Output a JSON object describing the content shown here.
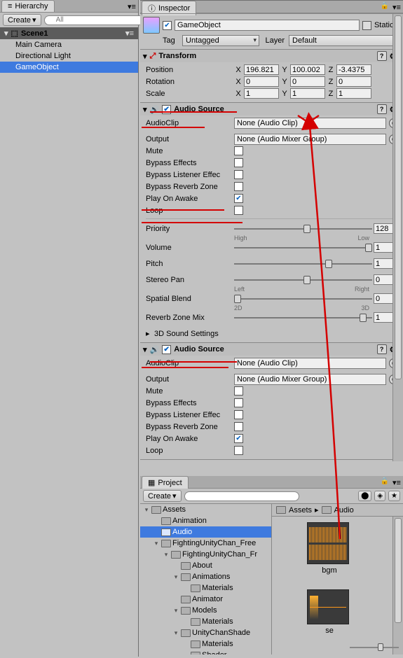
{
  "hierarchy": {
    "tab": "Hierarchy",
    "create": "Create",
    "search_placeholder": "All",
    "scene": "Scene1",
    "items": [
      "Main Camera",
      "Directional Light",
      "GameObject"
    ],
    "selected_index": 2
  },
  "inspector": {
    "tab": "Inspector",
    "gameobject": {
      "active": true,
      "name": "GameObject",
      "static": "Static",
      "tag_label": "Tag",
      "tag": "Untagged",
      "layer_label": "Layer",
      "layer": "Default"
    },
    "transform": {
      "title": "Transform",
      "position": {
        "label": "Position",
        "x": "196.821",
        "y": "100.002",
        "z": "-3.4375"
      },
      "rotation": {
        "label": "Rotation",
        "x": "0",
        "y": "0",
        "z": "0"
      },
      "scale": {
        "label": "Scale",
        "x": "1",
        "y": "1",
        "z": "1"
      }
    },
    "audio1": {
      "title": "Audio Source",
      "audioclip": {
        "label": "AudioClip",
        "value": "None (Audio Clip)"
      },
      "output": {
        "label": "Output",
        "value": "None (Audio Mixer Group)"
      },
      "mute": {
        "label": "Mute",
        "value": false
      },
      "bypass_effects": {
        "label": "Bypass Effects",
        "value": false
      },
      "bypass_listener": {
        "label": "Bypass Listener Effec",
        "value": false
      },
      "bypass_reverb": {
        "label": "Bypass Reverb Zone",
        "value": false
      },
      "play_on_awake": {
        "label": "Play On Awake",
        "value": true
      },
      "loop": {
        "label": "Loop",
        "value": false
      },
      "priority": {
        "label": "Priority",
        "low": "High",
        "high": "Low",
        "value": "128",
        "pct": 50
      },
      "volume": {
        "label": "Volume",
        "value": "1",
        "pct": 100
      },
      "pitch": {
        "label": "Pitch",
        "value": "1",
        "pct": 66
      },
      "stereo": {
        "label": "Stereo Pan",
        "low": "Left",
        "high": "Right",
        "value": "0",
        "pct": 50
      },
      "spatial": {
        "label": "Spatial Blend",
        "low": "2D",
        "high": "3D",
        "value": "0",
        "pct": 0
      },
      "reverbmix": {
        "label": "Reverb Zone Mix",
        "value": "1",
        "pct": 91
      },
      "sound3d": "3D Sound Settings"
    },
    "audio2": {
      "title": "Audio Source",
      "audioclip": {
        "label": "AudioClip",
        "value": "None (Audio Clip)"
      },
      "output": {
        "label": "Output",
        "value": "None (Audio Mixer Group)"
      },
      "mute": {
        "label": "Mute",
        "value": false
      },
      "bypass_effects": {
        "label": "Bypass Effects",
        "value": false
      },
      "bypass_listener": {
        "label": "Bypass Listener Effec",
        "value": false
      },
      "bypass_reverb": {
        "label": "Bypass Reverb Zone",
        "value": false
      },
      "play_on_awake": {
        "label": "Play On Awake",
        "value": true
      },
      "loop": {
        "label": "Loop",
        "value": false
      }
    }
  },
  "project": {
    "tab": "Project",
    "create": "Create",
    "search_placeholder": "",
    "tree": [
      {
        "depth": 0,
        "fold": "▾",
        "label": "Assets"
      },
      {
        "depth": 1,
        "fold": "",
        "label": "Animation"
      },
      {
        "depth": 1,
        "fold": "",
        "label": "Audio",
        "selected": true
      },
      {
        "depth": 1,
        "fold": "▾",
        "label": "FightingUnityChan_Free"
      },
      {
        "depth": 2,
        "fold": "▾",
        "label": "FightingUnityChan_Fr"
      },
      {
        "depth": 3,
        "fold": "",
        "label": "About"
      },
      {
        "depth": 3,
        "fold": "▾",
        "label": "Animations"
      },
      {
        "depth": 4,
        "fold": "",
        "label": "Materials"
      },
      {
        "depth": 3,
        "fold": "",
        "label": "Animator"
      },
      {
        "depth": 3,
        "fold": "▾",
        "label": "Models"
      },
      {
        "depth": 4,
        "fold": "",
        "label": "Materials"
      },
      {
        "depth": 3,
        "fold": "▾",
        "label": "UnityChanShade"
      },
      {
        "depth": 4,
        "fold": "",
        "label": "Materials"
      },
      {
        "depth": 4,
        "fold": "",
        "label": "Shader"
      }
    ],
    "breadcrumb": [
      "Assets",
      "Audio"
    ],
    "assets": [
      {
        "name": "bgm",
        "type": "wave"
      },
      {
        "name": "se",
        "type": "se"
      }
    ]
  }
}
